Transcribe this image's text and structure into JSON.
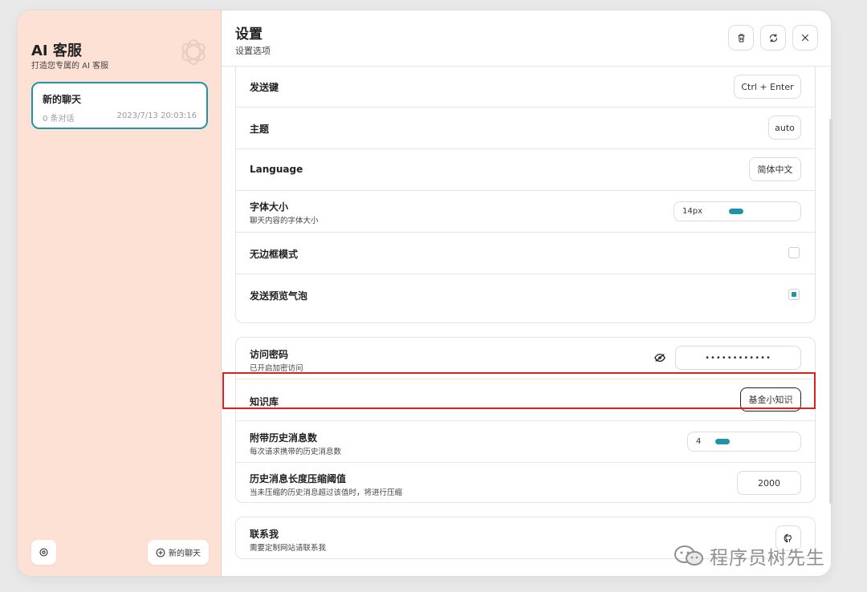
{
  "sidebar": {
    "title": "AI 客服",
    "subtitle": "打造您专属的 AI 客服",
    "logo_icon": "openai-logo-icon",
    "chat_item": {
      "title": "新的聊天",
      "count": "0 条对话",
      "date": "2023/7/13 20:03:16"
    },
    "settings_icon": "settings-gear-icon",
    "new_chat_label": "新的聊天",
    "new_chat_icon": "plus-circle-icon"
  },
  "header": {
    "title": "设置",
    "subtitle": "设置选项",
    "buttons": [
      "delete-icon",
      "reset-icon",
      "close-icon"
    ]
  },
  "settings": {
    "send_key": {
      "label": "发送键",
      "value": "Ctrl + Enter"
    },
    "theme": {
      "label": "主题",
      "value": "auto"
    },
    "language": {
      "label": "Language",
      "value": "简体中文"
    },
    "font_size": {
      "label": "字体大小",
      "desc": "聊天内容的字体大小",
      "value": "14px"
    },
    "borderless": {
      "label": "无边框模式",
      "checked": false
    },
    "send_preview": {
      "label": "发送预览气泡",
      "checked": true
    },
    "access_password": {
      "label": "访问密码",
      "desc": "已开启加密访问",
      "value": "••••••••••••"
    },
    "knowledge_base": {
      "label": "知识库",
      "value": "基金小知识"
    },
    "history_count": {
      "label": "附带历史消息数",
      "desc": "每次请求携带的历史消息数",
      "value": "4"
    },
    "compress_threshold": {
      "label": "历史消息长度压缩阈值",
      "desc": "当未压缩的历史消息超过该值时，将进行压缩",
      "value": "2000"
    },
    "contact": {
      "label": "联系我",
      "desc": "需要定制网站请联系我"
    }
  },
  "watermark": {
    "text": "程序员树先生"
  },
  "colors": {
    "accent": "#1f94a8",
    "sidebar_bg": "#fde1d4",
    "highlight": "#e01e1e"
  }
}
